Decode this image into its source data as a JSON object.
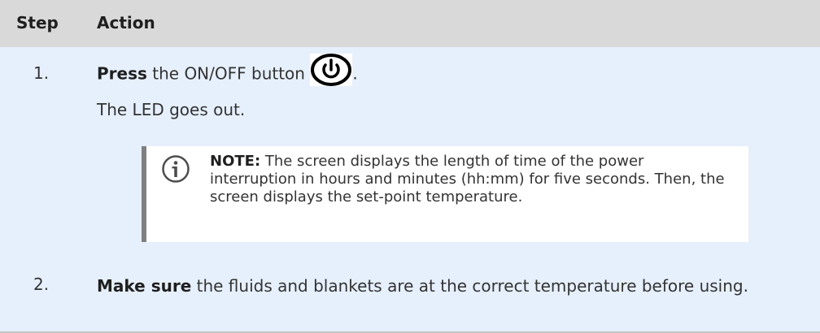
{
  "table": {
    "headers": {
      "step": "Step",
      "action": "Action"
    },
    "row1": {
      "step": "1.",
      "verb": "Press",
      "text_before_icon": " the ON/OFF button ",
      "text_after_icon": ".",
      "icon": "power-icon",
      "result": "The LED goes out."
    },
    "note": {
      "icon": "info-icon",
      "label": "NOTE:",
      "text": " The screen displays the length of time of the power interruption in hours and minutes (hh:mm) for five seconds. Then, the screen displays the set-point temperature."
    },
    "row2": {
      "step": "2.",
      "verb": "Make sure",
      "text": " the fluids and blankets are at the correct temperature before using."
    }
  },
  "colors": {
    "header_bg": "#d9d9d9",
    "row_bg": "#e6f0fc",
    "note_bg": "#ffffff",
    "note_bar": "#808080",
    "text": "#333333"
  }
}
